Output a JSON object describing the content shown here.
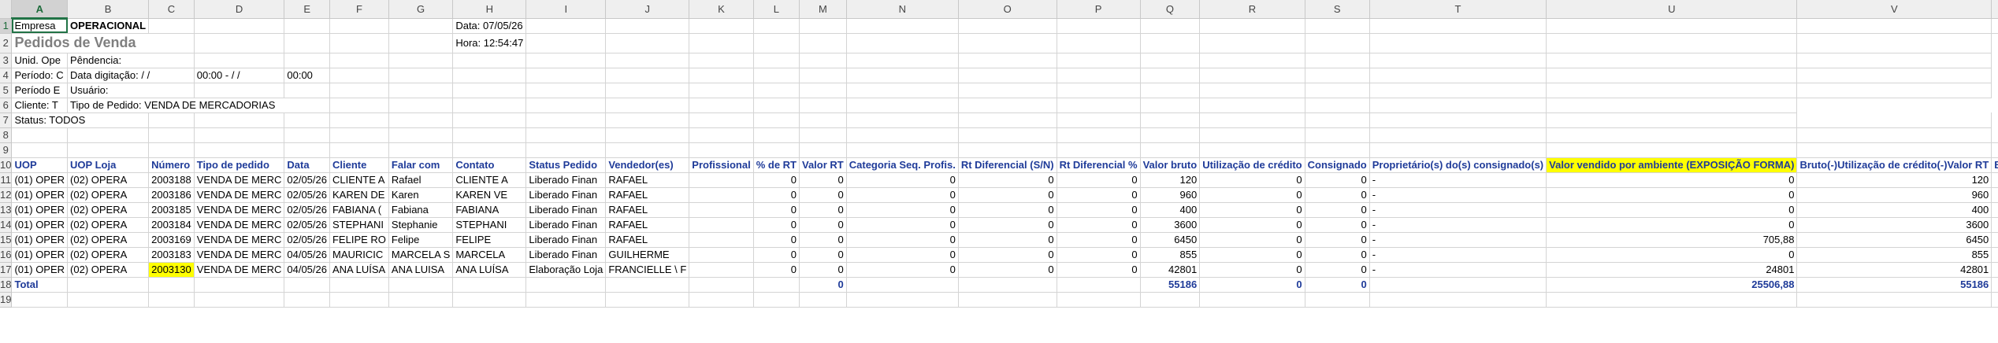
{
  "columns": [
    "A",
    "B",
    "C",
    "D",
    "E",
    "F",
    "G",
    "H",
    "I",
    "J",
    "K",
    "L",
    "M",
    "N",
    "O",
    "P",
    "Q",
    "R",
    "S",
    "T",
    "U",
    "V",
    ""
  ],
  "row_numbers": [
    "1",
    "2",
    "3",
    "4",
    "5",
    "6",
    "7",
    "8",
    "9",
    "10",
    "11",
    "12",
    "13",
    "14",
    "15",
    "16",
    "17",
    "18",
    "19"
  ],
  "active_cell": {
    "row": 1,
    "col": "A"
  },
  "colors": {
    "header_text": "#1f3b99",
    "highlight": "#ffff00",
    "selection": "#217346"
  },
  "info": {
    "empresa_label": "Empresa",
    "empresa_value": "OPERACIONAL",
    "title": "Pedidos de Venda",
    "date": "Data: 07/05/26",
    "time": "Hora: 12:54:47",
    "r3_a": "Unid. Ope",
    "r3_b": "Pêndencia:",
    "r4_a": "Período: C",
    "r4_b": "Data digitação:  / /",
    "r4_d": "00:00 -  / /",
    "r4_e": "00:00",
    "r5_a": "Período E",
    "r5_b": "Usuário:",
    "r6_a": "Cliente: T",
    "r6_b": "Tipo de Pedido: VENDA DE MERCADORIAS",
    "r7_a": "Status: TODOS"
  },
  "headers": [
    "UOP",
    "UOP Loja",
    "Número",
    "Tipo de pedido",
    "Data",
    "Cliente",
    "Falar com",
    "Contato",
    "Status Pedido",
    "Vendedor(es)",
    "Profissional",
    "% de RT",
    "Valor RT",
    "Categoria Seq. Profis.",
    "Rt Diferencial (S/N)",
    "Rt Diferencial %",
    "Valor bruto",
    "Utilização de crédito",
    "Consignado",
    "Proprietário(s) do(s) consignado(s)",
    "Valor vendido por ambiente (EXPOSIÇÃO FORMA)",
    "Bruto(-)Utilização de crédito(-)Valor RT",
    "Bruto(-)Utilizaç"
  ],
  "rows": [
    [
      "(01) OPER",
      "(02) OPERA",
      "2003188",
      "VENDA DE MERC",
      "02/05/26",
      "CLIENTE A",
      "Rafael",
      "CLIENTE A",
      "Liberado Finan",
      "RAFAEL",
      "",
      "0",
      "0",
      "0",
      "0",
      "0",
      "120",
      "0",
      "0",
      "-",
      "0",
      "120",
      ""
    ],
    [
      "(01) OPER",
      "(02) OPERA",
      "2003186",
      "VENDA DE MERC",
      "02/05/26",
      "KAREN DE",
      "Karen",
      "KAREN VE",
      "Liberado Finan",
      "RAFAEL",
      "",
      "0",
      "0",
      "0",
      "0",
      "0",
      "960",
      "0",
      "0",
      "-",
      "0",
      "960",
      ""
    ],
    [
      "(01) OPER",
      "(02) OPERA",
      "2003185",
      "VENDA DE MERC",
      "02/05/26",
      "FABIANA (",
      "Fabiana",
      "FABIANA",
      "Liberado Finan",
      "RAFAEL",
      "",
      "0",
      "0",
      "0",
      "0",
      "0",
      "400",
      "0",
      "0",
      "-",
      "0",
      "400",
      ""
    ],
    [
      "(01) OPER",
      "(02) OPERA",
      "2003184",
      "VENDA DE MERC",
      "02/05/26",
      "STEPHANI",
      "Stephanie",
      "STEPHANI",
      "Liberado Finan",
      "RAFAEL",
      "",
      "0",
      "0",
      "0",
      "0",
      "0",
      "3600",
      "0",
      "0",
      "-",
      "0",
      "3600",
      ""
    ],
    [
      "(01) OPER",
      "(02) OPERA",
      "2003169",
      "VENDA DE MERC",
      "02/05/26",
      "FELIPE RO",
      "Felipe",
      "FELIPE",
      "Liberado Finan",
      "RAFAEL",
      "",
      "0",
      "0",
      "0",
      "0",
      "0",
      "6450",
      "0",
      "0",
      "-",
      "705,88",
      "6450",
      ""
    ],
    [
      "(01) OPER",
      "(02) OPERA",
      "2003183",
      "VENDA DE MERC",
      "04/05/26",
      "MAURICIC",
      "MARCELA S",
      "MARCELA",
      "Liberado Finan",
      "GUILHERME",
      "",
      "0",
      "0",
      "0",
      "0",
      "0",
      "855",
      "0",
      "0",
      "-",
      "0",
      "855",
      ""
    ],
    [
      "(01) OPER",
      "(02) OPERA",
      "2003130",
      "VENDA DE MERC",
      "04/05/26",
      "ANA LUÍSA",
      "ANA LUISA",
      "ANA LUÍSA",
      "Elaboração Loja",
      "FRANCIELLE \\ F",
      "",
      "0",
      "0",
      "0",
      "0",
      "0",
      "42801",
      "0",
      "0",
      "-",
      "24801",
      "42801",
      ""
    ]
  ],
  "total": {
    "label": "Total",
    "valor_rt": "0",
    "valor_bruto": "55186",
    "credito": "0",
    "consignado": "0",
    "ambiente": "25506,88",
    "liquido": "55186"
  }
}
